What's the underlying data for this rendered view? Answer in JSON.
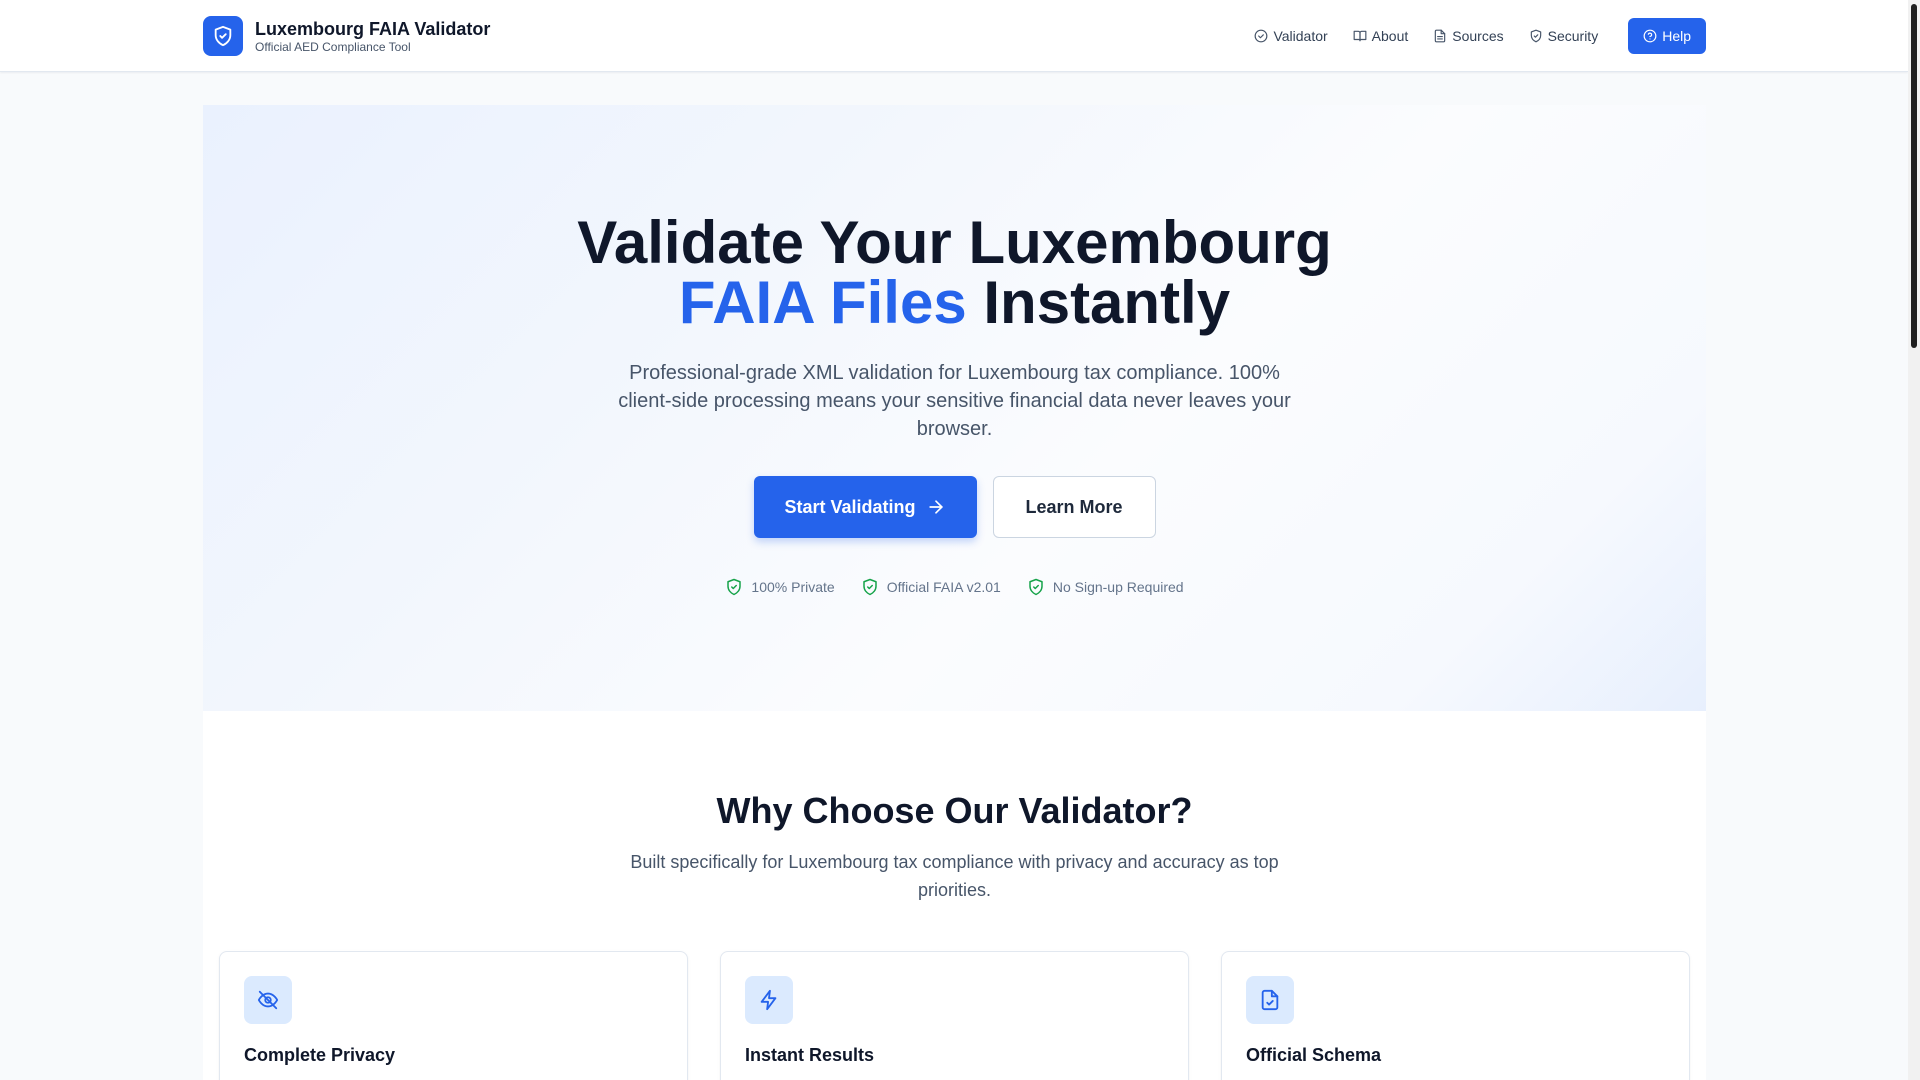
{
  "header": {
    "title": "Luxembourg FAIA Validator",
    "subtitle": "Official AED Compliance Tool",
    "nav": [
      {
        "label": "Validator",
        "icon": "check-circle-icon"
      },
      {
        "label": "About",
        "icon": "book-open-icon"
      },
      {
        "label": "Sources",
        "icon": "file-text-icon"
      },
      {
        "label": "Security",
        "icon": "shield-icon"
      }
    ],
    "help_label": "Help"
  },
  "hero": {
    "title_line1": "Validate Your Luxembourg",
    "title_accent": "FAIA Files",
    "title_rest": " Instantly",
    "description": "Professional-grade XML validation for Luxembourg tax compliance. 100% client-side processing means your sensitive financial data never leaves your browser.",
    "primary_cta": "Start Validating",
    "secondary_cta": "Learn More",
    "badges": [
      "100% Private",
      "Official FAIA v2.01",
      "No Sign-up Required"
    ]
  },
  "why": {
    "title": "Why Choose Our Validator?",
    "description": "Built specifically for Luxembourg tax compliance with privacy and accuracy as top priorities.",
    "cards": [
      {
        "title": "Complete Privacy",
        "icon": "eye-off-icon"
      },
      {
        "title": "Instant Results",
        "icon": "zap-icon"
      },
      {
        "title": "Official Schema",
        "icon": "file-check-icon"
      }
    ]
  },
  "colors": {
    "accent": "#2563eb",
    "badge_check": "#16a34a",
    "text": "#0f172a",
    "muted": "#475569"
  }
}
